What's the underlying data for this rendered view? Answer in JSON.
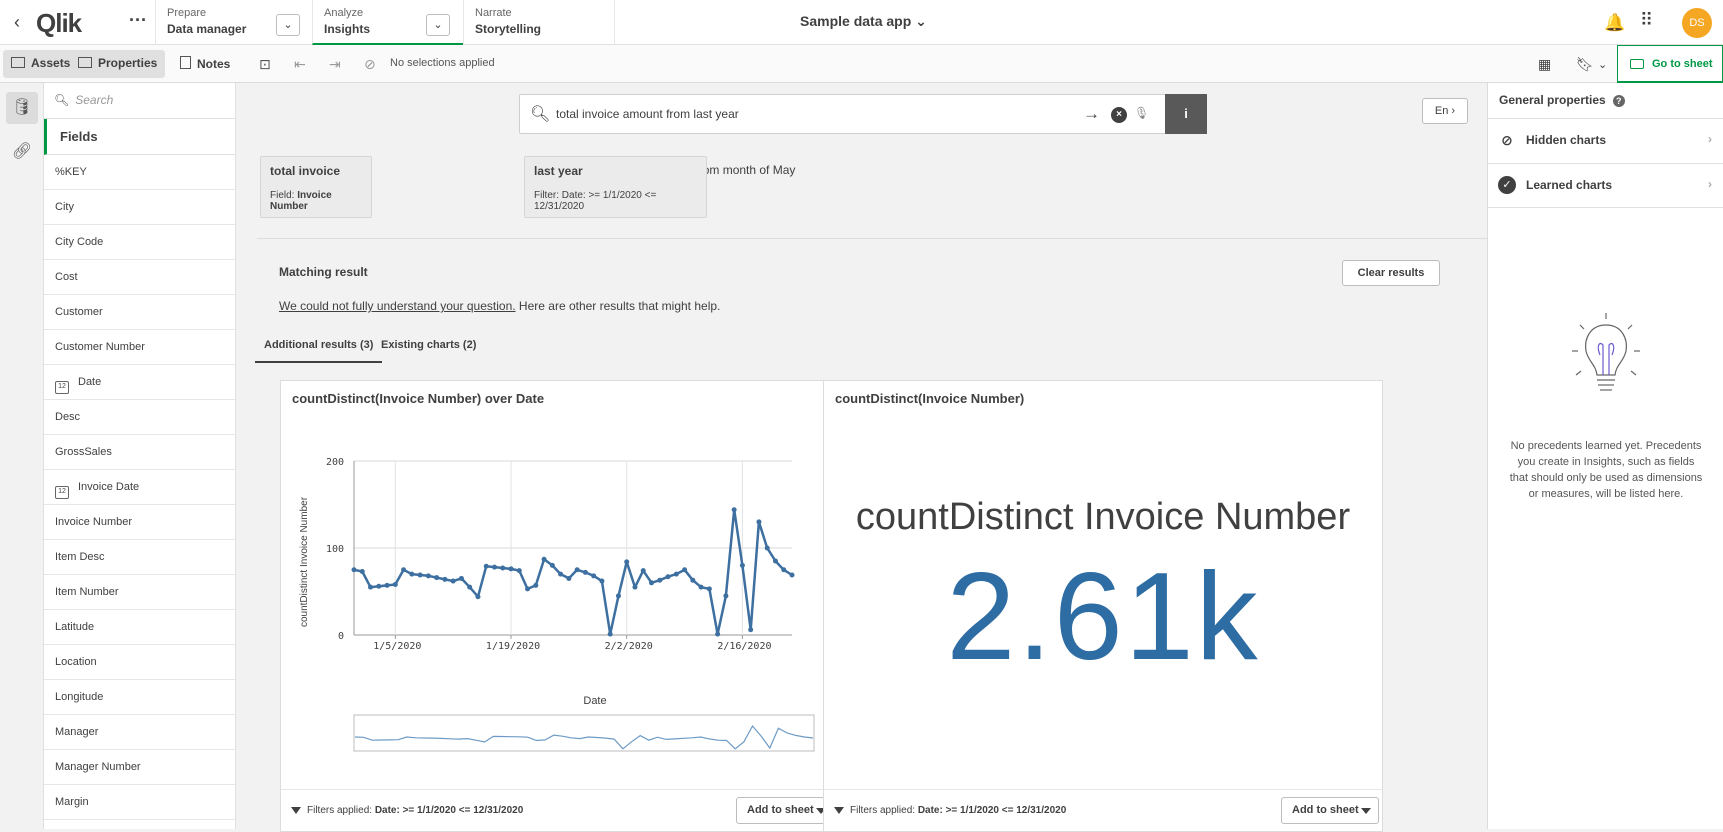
{
  "topbar": {
    "logo": "Qlik",
    "prepare": {
      "label": "Prepare",
      "value": "Data manager"
    },
    "analyze": {
      "label": "Analyze",
      "value": "Insights"
    },
    "narrate": {
      "label": "Narrate",
      "value": "Storytelling"
    },
    "app_title": "Sample data app",
    "avatar": "DS"
  },
  "toolbar": {
    "assets": "Assets",
    "properties": "Properties",
    "notes": "Notes",
    "no_selections": "No selections applied",
    "go_to_sheet": "Go to sheet"
  },
  "fields": {
    "search_placeholder": "Search",
    "header": "Fields",
    "items": [
      {
        "label": "%KEY",
        "icon": ""
      },
      {
        "label": "City",
        "icon": ""
      },
      {
        "label": "City Code",
        "icon": ""
      },
      {
        "label": "Cost",
        "icon": ""
      },
      {
        "label": "Customer",
        "icon": ""
      },
      {
        "label": "Customer Number",
        "icon": ""
      },
      {
        "label": "Date",
        "icon": "calendar-icon"
      },
      {
        "label": "Desc",
        "icon": ""
      },
      {
        "label": "GrossSales",
        "icon": ""
      },
      {
        "label": "Invoice Date",
        "icon": "calendar-icon"
      },
      {
        "label": "Invoice Number",
        "icon": ""
      },
      {
        "label": "Item Desc",
        "icon": ""
      },
      {
        "label": "Item Number",
        "icon": ""
      },
      {
        "label": "Latitude",
        "icon": ""
      },
      {
        "label": "Location",
        "icon": ""
      },
      {
        "label": "Longitude",
        "icon": ""
      },
      {
        "label": "Manager",
        "icon": ""
      },
      {
        "label": "Manager Number",
        "icon": ""
      },
      {
        "label": "Margin",
        "icon": ""
      }
    ]
  },
  "search": {
    "query": "total invoice amount from last year",
    "language": "En"
  },
  "chips": {
    "total_invoice": {
      "title": "total invoice",
      "sub_label": "Field:",
      "sub_value": "Invoice Number"
    },
    "middle_text": "amount from month of May",
    "last_year": {
      "title": "last year",
      "sub_label": "Filter:",
      "sub_value": "Date: >= 1/1/2020 <= 12/31/2020"
    }
  },
  "results": {
    "title": "Matching result",
    "clear": "Clear results",
    "not_understood_link": "We could not fully understand your question.",
    "not_understood_rest": " Here are other results that might help.",
    "tab_additional": "Additional results (3)",
    "tab_existing": "Existing charts (2)"
  },
  "card1": {
    "title": "countDistinct(Invoice Number) over Date",
    "filters_label": "Filters applied:",
    "filters_value": "Date: >= 1/1/2020 <= 12/31/2020",
    "add": "Add to sheet"
  },
  "card2": {
    "title": "countDistinct(Invoice Number)",
    "kpi_label": "countDistinct Invoice Number",
    "kpi_value": "2.61k",
    "filters_label": "Filters applied:",
    "filters_value": "Date: >= 1/1/2020 <= 12/31/2020",
    "add": "Add to sheet"
  },
  "right_panel": {
    "title": "General properties",
    "hidden_charts": "Hidden charts",
    "learned_charts": "Learned charts",
    "empty_message": "No precedents learned yet. Precedents you create in Insights, such as fields that should only be used as dimensions or measures, will be listed here."
  },
  "chart_data": {
    "type": "line",
    "xlabel": "Date",
    "ylabel": "countDistinct Invoice Number",
    "ylim": [
      0,
      200
    ],
    "yticks": [
      "0",
      "100",
      "200"
    ],
    "xticks": [
      "1/5/2020",
      "1/19/2020",
      "2/2/2020",
      "2/16/2020"
    ],
    "color": "#3d6fa0",
    "series": [
      {
        "x": [
          "2019-12-31",
          "2020-01-01",
          "2020-01-02",
          "2020-01-03",
          "2020-01-04",
          "2020-01-05",
          "2020-01-06",
          "2020-01-07",
          "2020-01-08",
          "2020-01-09",
          "2020-01-10",
          "2020-01-11",
          "2020-01-12",
          "2020-01-13",
          "2020-01-14",
          "2020-01-15",
          "2020-01-16",
          "2020-01-17",
          "2020-01-18",
          "2020-01-19",
          "2020-01-20",
          "2020-01-21",
          "2020-01-22",
          "2020-01-23",
          "2020-01-24",
          "2020-01-25",
          "2020-01-26",
          "2020-01-27",
          "2020-01-28",
          "2020-01-29",
          "2020-01-30",
          "2020-01-31",
          "2020-02-01",
          "2020-02-02",
          "2020-02-03",
          "2020-02-04",
          "2020-02-05",
          "2020-02-06",
          "2020-02-07",
          "2020-02-08",
          "2020-02-09",
          "2020-02-10",
          "2020-02-11",
          "2020-02-12",
          "2020-02-13",
          "2020-02-14",
          "2020-02-15",
          "2020-02-16",
          "2020-02-17",
          "2020-02-18",
          "2020-02-19",
          "2020-02-20",
          "2020-02-21",
          "2020-02-22"
        ],
        "values": [
          75,
          73,
          55,
          56,
          57,
          58,
          75,
          70,
          69,
          68,
          66,
          64,
          62,
          65,
          55,
          44,
          79,
          78,
          77,
          76,
          74,
          53,
          57,
          87,
          80,
          70,
          65,
          75,
          72,
          68,
          62,
          1,
          45,
          84,
          55,
          74,
          60,
          63,
          67,
          70,
          75,
          63,
          55,
          53,
          1,
          45,
          144,
          80,
          6,
          130,
          100,
          85,
          75,
          69
        ]
      }
    ]
  }
}
